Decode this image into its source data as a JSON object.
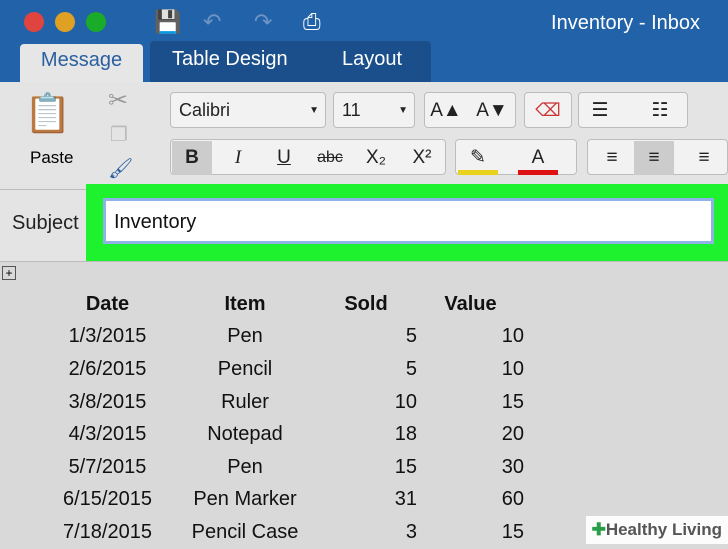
{
  "window": {
    "title": "Inventory - Inbox",
    "colors": {
      "close": "#e0443e",
      "minimize": "#dea123",
      "zoom": "#1aab29",
      "titlebar": "#2162a8",
      "highlight": "#1ef22e"
    }
  },
  "tabs": [
    {
      "label": "Message"
    },
    {
      "label": "Table Design"
    },
    {
      "label": "Layout"
    }
  ],
  "ribbon": {
    "paste": "Paste",
    "font": "Calibri",
    "size": "11",
    "bold": "B",
    "italic": "I",
    "underline": "U",
    "strike": "abc",
    "subscript": "X₂",
    "superscript": "X²",
    "grow": "A▲",
    "shrink": "A▼",
    "font_color": "A"
  },
  "subject": {
    "label": "Subject",
    "value": "Inventory"
  },
  "table": {
    "headers": [
      "Date",
      "Item",
      "Sold",
      "Value"
    ],
    "rows": [
      [
        "1/3/2015",
        "Pen",
        "5",
        "10"
      ],
      [
        "2/6/2015",
        "Pencil",
        "5",
        "10"
      ],
      [
        "3/8/2015",
        "Ruler",
        "10",
        "15"
      ],
      [
        "4/3/2015",
        "Notepad",
        "18",
        "20"
      ],
      [
        "5/7/2015",
        "Pen",
        "15",
        "30"
      ],
      [
        "6/15/2015",
        "Pen Marker",
        "31",
        "60"
      ],
      [
        "7/18/2015",
        "Pencil Case",
        "3",
        "15"
      ]
    ]
  },
  "watermark": "Healthy Living"
}
